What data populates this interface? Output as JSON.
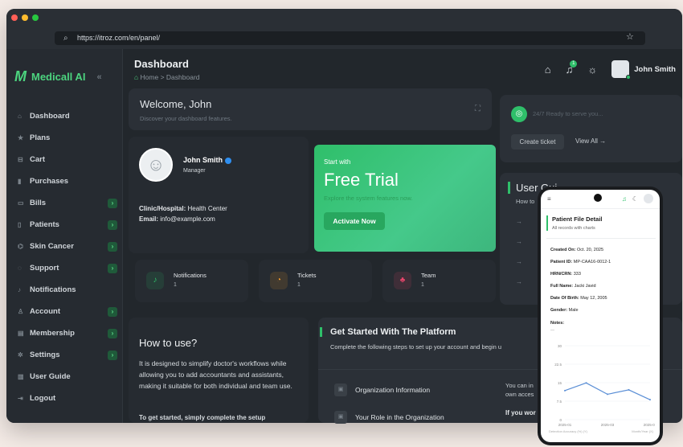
{
  "browser": {
    "url": "https://itroz.com/en/panel/"
  },
  "app": {
    "brand": "Medicall AI",
    "collapse_glyph": "«"
  },
  "sidebar": {
    "items": [
      {
        "label": "Dashboard",
        "icon": "home-icon",
        "glyph": "⌂",
        "has_sub": false
      },
      {
        "label": "Plans",
        "icon": "star-icon",
        "glyph": "★",
        "has_sub": false
      },
      {
        "label": "Cart",
        "icon": "cart-icon",
        "glyph": "⊟",
        "has_sub": false
      },
      {
        "label": "Purchases",
        "icon": "bookmark-icon",
        "glyph": "▮",
        "has_sub": false
      },
      {
        "label": "Bills",
        "icon": "bill-icon",
        "glyph": "▭",
        "has_sub": true
      },
      {
        "label": "Patients",
        "icon": "patients-icon",
        "glyph": "▯",
        "has_sub": true
      },
      {
        "label": "Skin Cancer",
        "icon": "skin-icon",
        "glyph": "⌬",
        "has_sub": true
      },
      {
        "label": "Support",
        "icon": "support-icon",
        "glyph": "◌",
        "has_sub": true
      },
      {
        "label": "Notifications",
        "icon": "bell-icon",
        "glyph": "♪",
        "has_sub": false
      },
      {
        "label": "Account",
        "icon": "account-icon",
        "glyph": "♙",
        "has_sub": true
      },
      {
        "label": "Membership",
        "icon": "membership-icon",
        "glyph": "▤",
        "has_sub": true
      },
      {
        "label": "Settings",
        "icon": "gear-icon",
        "glyph": "✲",
        "has_sub": true
      },
      {
        "label": "User Guide",
        "icon": "guide-icon",
        "glyph": "▥",
        "has_sub": false
      },
      {
        "label": "Logout",
        "icon": "logout-icon",
        "glyph": "⇥",
        "has_sub": false
      }
    ]
  },
  "header": {
    "title": "Dashboard",
    "crumb_home": "Home",
    "crumb_sep": ">",
    "crumb_current": "Dashboard",
    "notif_count": "1",
    "user_name": "John Smith"
  },
  "welcome": {
    "title": "Welcome, John",
    "subtitle": "Discover your dashboard features."
  },
  "profile": {
    "name": "John Smith",
    "role": "Manager",
    "clinic_label": "Clinic/Hospital:",
    "clinic_value": "Health Center",
    "email_label": "Email:",
    "email_value": "info@example.com"
  },
  "trial": {
    "kicker": "Start with",
    "title": "Free Trial",
    "desc": "Explore the system features now.",
    "button": "Activate Now"
  },
  "support": {
    "status": "24/7 Ready to serve you...",
    "create_ticket": "Create ticket",
    "view_all": "View All →"
  },
  "guide": {
    "title": "User Gui",
    "subtitle": "How to"
  },
  "stats": [
    {
      "title": "Notifications",
      "value": "1",
      "icon": "bell-icon",
      "glyph": "♪",
      "color": "#2fbf6a"
    },
    {
      "title": "Tickets",
      "value": "1",
      "icon": "ticket-icon",
      "glyph": "◔",
      "color": "#f59b2a"
    },
    {
      "title": "Team",
      "value": "1",
      "icon": "team-icon",
      "glyph": "♣",
      "color": "#e8456b"
    }
  ],
  "howto": {
    "title": "How to use?",
    "body": "It is designed to simplify doctor's workflows while allowing you to add accountants and assistants, making it suitable for both individual and team use.",
    "cutoff": "To get started, simply complete the setup"
  },
  "getstarted": {
    "title": "Get Started With The Platform",
    "subtitle": "Complete the following steps to set up your account and begin u",
    "steps": [
      {
        "label": "Organization Information"
      },
      {
        "label": "Your Role in the Organization"
      }
    ],
    "right_text": "You can in\nown acces",
    "right_text2": "If you wor"
  },
  "phone": {
    "title": "Patient File Detail",
    "subtitle": "All records with charts",
    "fields": [
      {
        "label": "Created On:",
        "value": "Oct. 20, 2025"
      },
      {
        "label": "Patient ID:",
        "value": "MP-CAA16-0012-1"
      },
      {
        "label": "HRN/CRN:",
        "value": "333"
      },
      {
        "label": "Full Name:",
        "value": "Jacki Javid"
      },
      {
        "label": "Date Of Birth:",
        "value": "May 12, 2005"
      },
      {
        "label": "Gender:",
        "value": "Male"
      }
    ],
    "notes_label": "Notes:",
    "notes_value": "—"
  },
  "chart_data": {
    "type": "line",
    "x": [
      "2025-01",
      "2025-02",
      "2025-03",
      "2025-04",
      "2025-05"
    ],
    "x_tick_labels": [
      "2025-01",
      "2025-03",
      "2025-05"
    ],
    "values": [
      11.8,
      14.9,
      10.3,
      12.1,
      8.1
    ],
    "ylim": [
      0,
      30
    ],
    "yticks": [
      "30",
      "22.5",
      "15",
      "7.5",
      "0"
    ],
    "xlabel": "Month/Year (X)",
    "ylabel_legend": "Detection Accuracy (%) (Y)",
    "color": "#5b8fd6"
  }
}
